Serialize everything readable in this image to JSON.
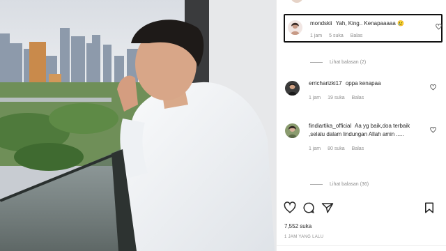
{
  "comments": [
    {
      "username": "mondskii",
      "text": "Yah, King.. Kenapaaaaa 😢",
      "time": "1 jam",
      "likes": "5 suka",
      "reply": "Balas"
    },
    {
      "username": "erricharizki17",
      "text": "oppa kenapaa",
      "time": "1 jam",
      "likes": "19 suka",
      "reply": "Balas"
    },
    {
      "username": "findiartika_official",
      "text": "Aa yg baik,doa terbaik ,selalu dalam lindungan Allah amin .....",
      "time": "1 jam",
      "likes": "80 suka",
      "reply": "Balas"
    }
  ],
  "view_replies": [
    "Lihat balasan (2)",
    "Lihat balasan (36)"
  ],
  "post": {
    "likes": "7,552 suka",
    "time_ago": "1 JAM YANG LALU"
  },
  "icons": {
    "like": "heart-outline",
    "comment": "speech-bubble",
    "share": "paper-plane",
    "save": "bookmark"
  }
}
